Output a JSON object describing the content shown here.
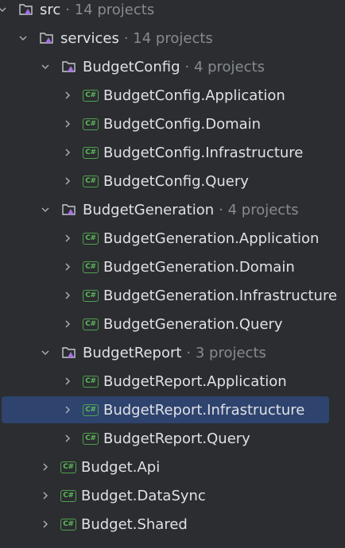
{
  "tree": [
    {
      "name": "src",
      "meta": "· 14 projects",
      "type": "folder",
      "expanded": true,
      "level": 0
    },
    {
      "name": "services",
      "meta": "· 14 projects",
      "type": "folder",
      "expanded": true,
      "level": 1
    },
    {
      "name": "BudgetConfig",
      "meta": "· 4 projects",
      "type": "folder",
      "expanded": true,
      "level": 2
    },
    {
      "name": "BudgetConfig.Application",
      "type": "csharp",
      "expanded": false,
      "level": 3
    },
    {
      "name": "BudgetConfig.Domain",
      "type": "csharp",
      "expanded": false,
      "level": 3
    },
    {
      "name": "BudgetConfig.Infrastructure",
      "type": "csharp",
      "expanded": false,
      "level": 3
    },
    {
      "name": "BudgetConfig.Query",
      "type": "csharp",
      "expanded": false,
      "level": 3
    },
    {
      "name": "BudgetGeneration",
      "meta": "· 4 projects",
      "type": "folder",
      "expanded": true,
      "level": 2
    },
    {
      "name": "BudgetGeneration.Application",
      "type": "csharp",
      "expanded": false,
      "level": 3
    },
    {
      "name": "BudgetGeneration.Domain",
      "type": "csharp",
      "expanded": false,
      "level": 3
    },
    {
      "name": "BudgetGeneration.Infrastructure",
      "type": "csharp",
      "expanded": false,
      "level": 3
    },
    {
      "name": "BudgetGeneration.Query",
      "type": "csharp",
      "expanded": false,
      "level": 3
    },
    {
      "name": "BudgetReport",
      "meta": "· 3 projects",
      "type": "folder",
      "expanded": true,
      "level": 2
    },
    {
      "name": "BudgetReport.Application",
      "type": "csharp",
      "expanded": false,
      "level": 3
    },
    {
      "name": "BudgetReport.Infrastructure",
      "type": "csharp",
      "expanded": false,
      "level": 3,
      "selected": true
    },
    {
      "name": "BudgetReport.Query",
      "type": "csharp",
      "expanded": false,
      "level": 3
    },
    {
      "name": "Budget.Api",
      "type": "csharp",
      "expanded": false,
      "level": 2
    },
    {
      "name": "Budget.DataSync",
      "type": "csharp",
      "expanded": false,
      "level": 2
    },
    {
      "name": "Budget.Shared",
      "type": "csharp",
      "expanded": false,
      "level": 2
    }
  ],
  "csharp_badge": "C#",
  "colors": {
    "background": "#2b2d30",
    "selection": "#2e436e",
    "text": "#dfe1e5",
    "meta": "#868a91",
    "csharp": "#4fa04e",
    "folder_accent": "#a571e6"
  }
}
